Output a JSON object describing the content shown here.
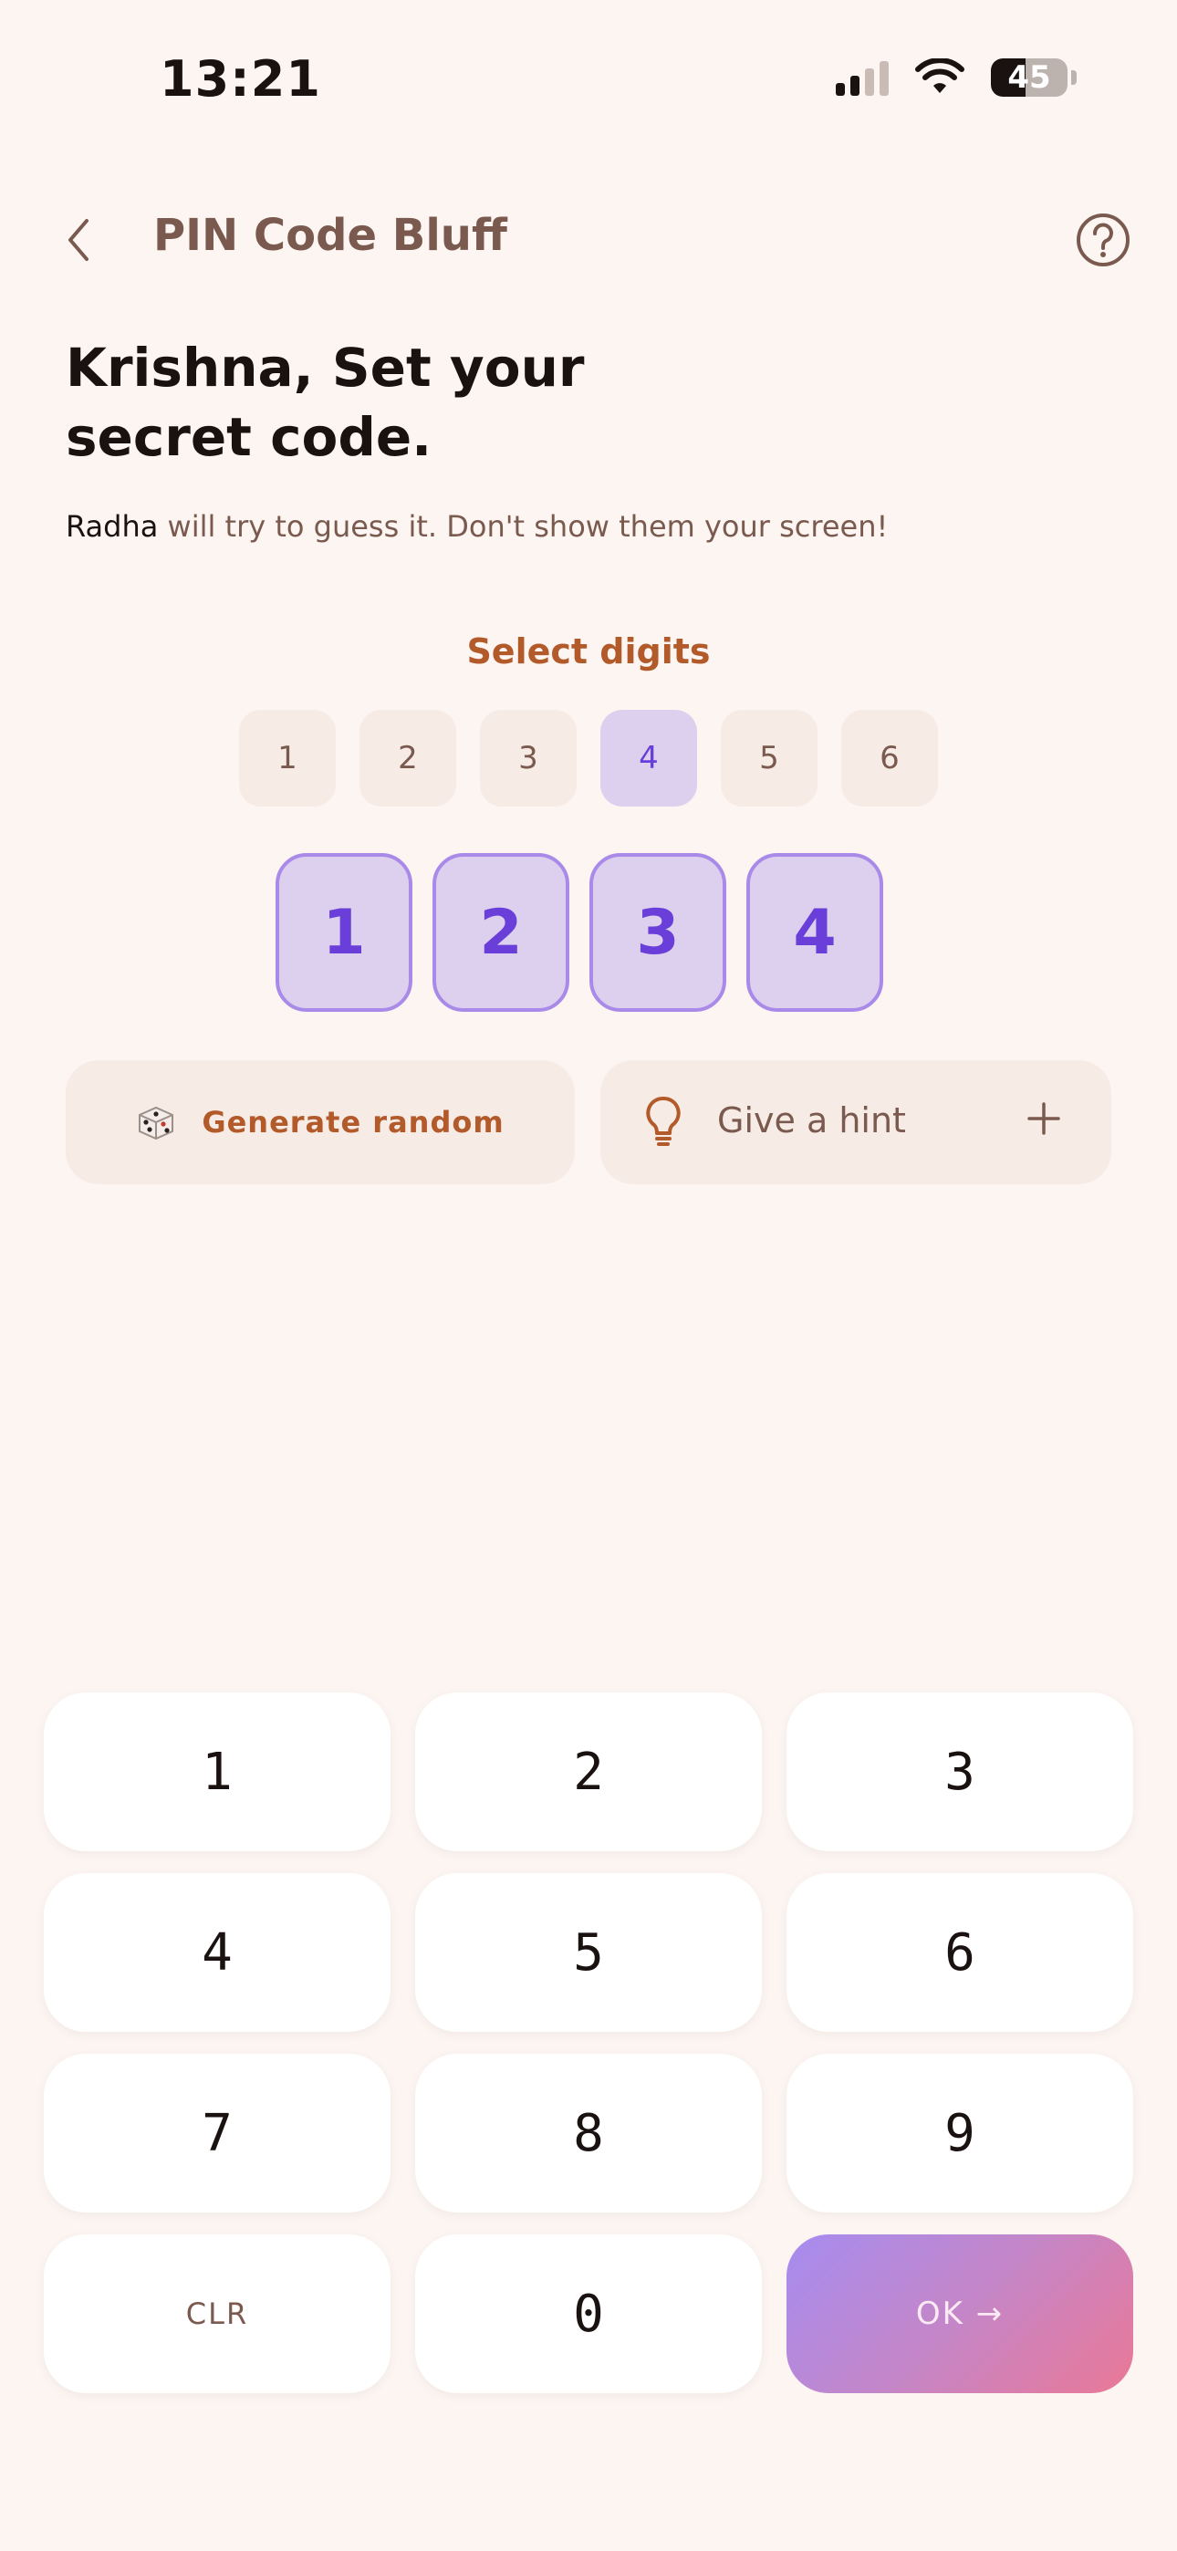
{
  "status_bar": {
    "time": "13:21",
    "battery_percent": "45",
    "battery_level": 0.45,
    "signal_bars_active": 2,
    "icons": [
      "signal-icon",
      "wifi-icon",
      "battery-icon"
    ]
  },
  "header": {
    "back_icon": "chevron-left-icon",
    "title": "PIN Code Bluff",
    "help_icon": "question-circle-icon"
  },
  "headline": {
    "line1": "Krishna, Set your",
    "line2": "secret code."
  },
  "subtext": {
    "name": "Radha",
    "rest": " will try to guess it. Don't show them your screen!"
  },
  "digit_selector": {
    "label": "Select digits",
    "options": [
      "1",
      "2",
      "3",
      "4",
      "5",
      "6"
    ],
    "selected": "4"
  },
  "pin": {
    "digits": [
      "1",
      "2",
      "3",
      "4"
    ]
  },
  "actions": {
    "generate_label": "Generate random",
    "generate_icon": "dice-icon",
    "hint_label": "Give a hint",
    "hint_icon": "lightbulb-icon",
    "hint_add_icon": "plus-icon"
  },
  "keypad": {
    "keys": [
      "1",
      "2",
      "3",
      "4",
      "5",
      "6",
      "7",
      "8",
      "9"
    ],
    "clear_label": "CLR",
    "zero_label": "0",
    "ok_label": "OK →"
  },
  "colors": {
    "background": "#fcf5f2",
    "accent_purple": "#6a3ed8",
    "accent_orange": "#b25a2a",
    "ok_gradient_start": "#a68cf0",
    "ok_gradient_end": "#ea7896"
  }
}
